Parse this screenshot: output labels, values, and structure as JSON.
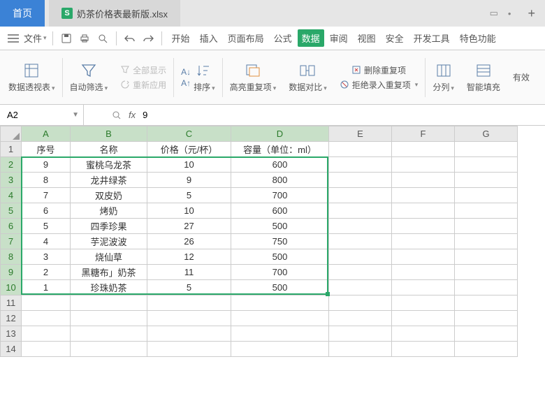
{
  "tabs": {
    "home": "首页",
    "filename": "奶茶价格表最新版.xlsx"
  },
  "menu": {
    "file": "文件",
    "items": [
      "开始",
      "插入",
      "页面布局",
      "公式",
      "数据",
      "审阅",
      "视图",
      "安全",
      "开发工具",
      "特色功能"
    ],
    "active_index": 4
  },
  "ribbon": {
    "pivot": "数据透视表",
    "autofilter": "自动筛选",
    "showall": "全部显示",
    "reapply": "重新应用",
    "sort": "排序",
    "highlight_dup": "高亮重复项",
    "data_compare": "数据对比",
    "remove_dup": "删除重复项",
    "reject_dup": "拒绝录入重复项",
    "text_to_col": "分列",
    "smart_fill": "智能填充",
    "validity": "有效"
  },
  "namebox": "A2",
  "formula_value": "9",
  "columns": [
    "A",
    "B",
    "C",
    "D",
    "E",
    "F",
    "G"
  ],
  "headers": {
    "a": "序号",
    "b": "名称",
    "c": "价格（元/杯）",
    "d": "容量（单位：ml）"
  },
  "rows": [
    {
      "n": "9",
      "name": "蜜桃乌龙茶",
      "price": "10",
      "vol": "600"
    },
    {
      "n": "8",
      "name": "龙井绿茶",
      "price": "9",
      "vol": "800"
    },
    {
      "n": "7",
      "name": "双皮奶",
      "price": "5",
      "vol": "700"
    },
    {
      "n": "6",
      "name": "烤奶",
      "price": "10",
      "vol": "600"
    },
    {
      "n": "5",
      "name": "四季珍果",
      "price": "27",
      "vol": "500"
    },
    {
      "n": "4",
      "name": "芋泥波波",
      "price": "26",
      "vol": "750"
    },
    {
      "n": "3",
      "name": "烧仙草",
      "price": "12",
      "vol": "500"
    },
    {
      "n": "2",
      "name": "黑糖布」奶茶",
      "price": "11",
      "vol": "700"
    },
    {
      "n": "1",
      "name": "珍珠奶茶",
      "price": "5",
      "vol": "500"
    }
  ],
  "chart_data": {
    "type": "table",
    "title": "奶茶价格表",
    "columns": [
      "序号",
      "名称",
      "价格（元/杯）",
      "容量（单位：ml）"
    ],
    "data": [
      [
        9,
        "蜜桃乌龙茶",
        10,
        600
      ],
      [
        8,
        "龙井绿茶",
        9,
        800
      ],
      [
        7,
        "双皮奶",
        5,
        700
      ],
      [
        6,
        "烤奶",
        10,
        600
      ],
      [
        5,
        "四季珍果",
        27,
        500
      ],
      [
        4,
        "芋泥波波",
        26,
        750
      ],
      [
        3,
        "烧仙草",
        12,
        500
      ],
      [
        2,
        "黑糖布」奶茶",
        11,
        700
      ],
      [
        1,
        "珍珠奶茶",
        5,
        500
      ]
    ]
  }
}
